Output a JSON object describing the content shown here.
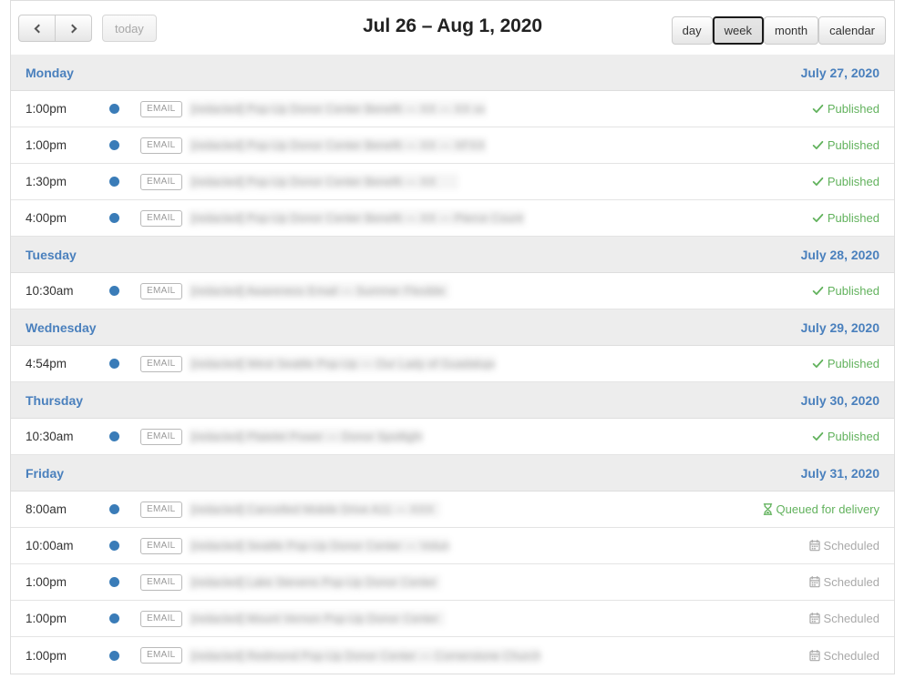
{
  "toolbar": {
    "prev_label": "",
    "next_label": "",
    "today_label": "today",
    "title": "Jul 26 – Aug 1, 2020",
    "views": [
      {
        "label": "day",
        "active": false
      },
      {
        "label": "week",
        "active": true
      },
      {
        "label": "month",
        "active": false
      },
      {
        "label": "calendar",
        "active": false
      }
    ]
  },
  "colors": {
    "accent_blue": "#4a80bd",
    "dot_blue": "#3a7cb8",
    "success_green": "#62b25d",
    "muted_gray": "#a9a9a9",
    "day_header_bg": "#ededed",
    "border": "#dddddd"
  },
  "status_labels": {
    "published": "Published",
    "queued": "Queued for delivery",
    "scheduled": "Scheduled"
  },
  "channel_tag": "EMAIL",
  "days": [
    {
      "name": "Monday",
      "date": "July 27, 2020",
      "events": [
        {
          "time": "1:00pm",
          "tag": "EMAIL",
          "title": "[redacted] Pop-Up Donor Center Benefit  —  XX  —  XX xx",
          "title_width": 325,
          "status": "published",
          "status_label": "Published"
        },
        {
          "time": "1:00pm",
          "tag": "EMAIL",
          "title": "[redacted] Pop-Up Donor Center Benefit  —  XX  —  XFXX",
          "title_width": 325,
          "status": "published",
          "status_label": "Published"
        },
        {
          "time": "1:30pm",
          "tag": "EMAIL",
          "title": "[redacted] Pop-Up Donor Center Benefit  —  XX",
          "title_width": 295,
          "status": "published",
          "status_label": "Published"
        },
        {
          "time": "4:00pm",
          "tag": "EMAIL",
          "title": "[redacted] Pop-Up Donor Center Benefit  —  XX  —  Pierce County",
          "title_width": 367,
          "status": "published",
          "status_label": "Published"
        }
      ]
    },
    {
      "name": "Tuesday",
      "date": "July 28, 2020",
      "events": [
        {
          "time": "10:30am",
          "tag": "EMAIL",
          "title": "[redacted] Awareness Email  —  Summer Flexible",
          "title_width": 285,
          "status": "published",
          "status_label": "Published"
        }
      ]
    },
    {
      "name": "Wednesday",
      "date": "July 29, 2020",
      "events": [
        {
          "time": "4:54pm",
          "tag": "EMAIL",
          "title": "[redacted] West Seattle Pop-Up  —  Our Lady of Guadalupe",
          "title_width": 335,
          "status": "published",
          "status_label": "Published"
        }
      ]
    },
    {
      "name": "Thursday",
      "date": "July 30, 2020",
      "events": [
        {
          "time": "10:30am",
          "tag": "EMAIL",
          "title": "[redacted] Platelet Power  —  Donor Spotlight",
          "title_width": 255,
          "status": "published",
          "status_label": "Published"
        }
      ]
    },
    {
      "name": "Friday",
      "date": "July 31, 2020",
      "events": [
        {
          "time": "8:00am",
          "tag": "EMAIL",
          "title": "[redacted] Cancelled Mobile Drive A11  —  XXX",
          "title_width": 275,
          "status": "queued",
          "status_label": "Queued for delivery"
        },
        {
          "time": "10:00am",
          "tag": "EMAIL",
          "title": "[redacted] Seattle Pop-Up Donor Center  —  Volunteer",
          "title_width": 285,
          "status": "scheduled",
          "status_label": "Scheduled"
        },
        {
          "time": "1:00pm",
          "tag": "EMAIL",
          "title": "[redacted] Lake Stevens Pop-Up Donor Center",
          "title_width": 275,
          "status": "scheduled",
          "status_label": "Scheduled"
        },
        {
          "time": "1:00pm",
          "tag": "EMAIL",
          "title": "[redacted] Mount Vernon Pop-Up Donor Center",
          "title_width": 280,
          "status": "scheduled",
          "status_label": "Scheduled"
        },
        {
          "time": "1:00pm",
          "tag": "EMAIL",
          "title": "[redacted] Redmond Pop-Up Donor Center  —  Cornerstone Church",
          "title_width": 385,
          "status": "scheduled",
          "status_label": "Scheduled"
        }
      ]
    }
  ]
}
